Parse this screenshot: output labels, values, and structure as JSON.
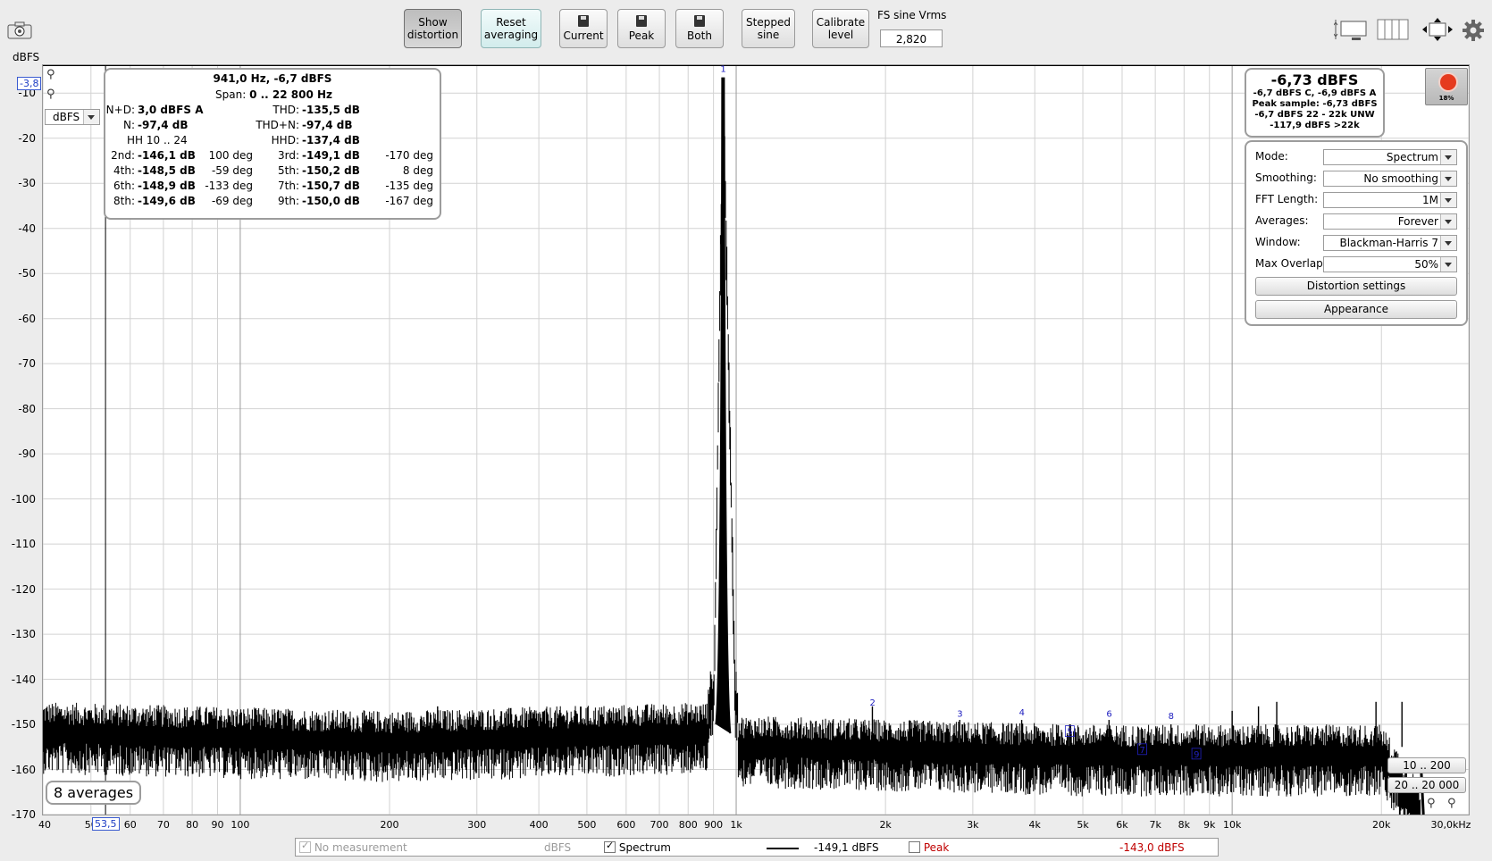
{
  "toolbar": {
    "show_distortion": [
      "Show",
      "distortion"
    ],
    "reset_averaging": [
      "Reset",
      "averaging"
    ],
    "current": "Current",
    "peak": "Peak",
    "both": "Both",
    "stepped_sine": [
      "Stepped",
      "sine"
    ],
    "calibrate_level": [
      "Calibrate",
      "level"
    ],
    "fs_label": "FS sine Vrms",
    "fs_value": "2,820"
  },
  "y_axis": {
    "unit": "dBFS",
    "selector": "dBFS",
    "cursor_value": "-3,8",
    "ticks": [
      "-10",
      "-20",
      "-30",
      "-40",
      "-50",
      "-60",
      "-70",
      "-80",
      "-90",
      "-100",
      "-110",
      "-120",
      "-130",
      "-140",
      "-150",
      "-160",
      "-170"
    ]
  },
  "x_axis": {
    "ticks": [
      "40",
      "50",
      "60",
      "70",
      "80",
      "90",
      "100",
      "200",
      "300",
      "400",
      "500",
      "600",
      "700",
      "800",
      "900",
      "1k",
      "2k",
      "3k",
      "4k",
      "5k",
      "6k",
      "7k",
      "8k",
      "9k",
      "10k",
      "20k",
      "30,0kHz"
    ],
    "cursor_value": "53,5"
  },
  "distortion_panel": {
    "title": "941,0 Hz, -6,7 dBFS",
    "span": "Span:",
    "span_value": "0 .. 22 800 Hz",
    "rows": [
      {
        "l1": "N+D:",
        "v1": "3,0 dBFS A",
        "l2": "THD:",
        "v2": "-135,5 dB",
        "p1": "",
        "p2": ""
      },
      {
        "l1": "N:",
        "v1": "-97,4 dB",
        "l2": "THD+N:",
        "v2": "-97,4 dB",
        "p1": "",
        "p2": ""
      },
      {
        "l1": "HH 10 .. 24",
        "v1": "",
        "l2": "HHD:",
        "v2": "-137,4 dB",
        "p1": "",
        "p2": ""
      },
      {
        "l1": "2nd:",
        "v1": "-146,1 dB",
        "p1": "100 deg",
        "l2": "3rd:",
        "v2": "-149,1 dB",
        "p2": "-170 deg"
      },
      {
        "l1": "4th:",
        "v1": "-148,5 dB",
        "p1": "-59 deg",
        "l2": "5th:",
        "v2": "-150,2 dB",
        "p2": "8 deg"
      },
      {
        "l1": "6th:",
        "v1": "-148,9 dB",
        "p1": "-133 deg",
        "l2": "7th:",
        "v2": "-150,7 dB",
        "p2": "-135 deg"
      },
      {
        "l1": "8th:",
        "v1": "-149,6 dB",
        "p1": "-69 deg",
        "l2": "9th:",
        "v2": "-150,0 dB",
        "p2": "-167 deg"
      }
    ]
  },
  "level_panel": {
    "main": "-6,73 dBFS",
    "lines": [
      "-6,7 dBFS C, -6,9 dBFS A",
      "Peak sample: -6,73 dBFS",
      "-6,7 dBFS 22 - 22k UNW",
      "-117,9 dBFS >22k"
    ]
  },
  "record": {
    "percent": "18%",
    "color": "#e53a1e"
  },
  "settings": [
    {
      "label": "Mode:",
      "value": "Spectrum"
    },
    {
      "label": "Smoothing:",
      "value": "No  smoothing"
    },
    {
      "label": "FFT Length:",
      "value": "1M"
    },
    {
      "label": "Averages:",
      "value": "Forever"
    },
    {
      "label": "Window:",
      "value": "Blackman-Harris 7"
    },
    {
      "label": "Max Overlap:",
      "value": "50%"
    }
  ],
  "buttons": {
    "distortion_settings": "Distortion settings",
    "appearance": "Appearance"
  },
  "averages_badge": "8 averages",
  "range_buttons": [
    "10 .. 200",
    "20 .. 20 000"
  ],
  "harmonic_markers": [
    "1",
    "2",
    "3",
    "4",
    "5",
    "6",
    "7",
    "8",
    "9"
  ],
  "legend": {
    "no_measurement": "No measurement",
    "no_measurement_unit": "dBFS",
    "spectrum": "Spectrum",
    "spectrum_value": "-149,1 dBFS",
    "peak": "Peak",
    "peak_value": "-143,0 dBFS",
    "peak_color": "#c00000"
  },
  "chart_data": {
    "type": "line",
    "x_scale": "log",
    "xlim": [
      40,
      30000
    ],
    "ylim": [
      -170,
      -3.8
    ],
    "ylabel": "dBFS",
    "fundamental": {
      "freq": 941,
      "level": -6.7
    },
    "noise_floor": [
      [
        40,
        -152
      ],
      [
        200,
        -154
      ],
      [
        900,
        -152
      ],
      [
        941,
        -8
      ],
      [
        1000,
        -155
      ],
      [
        5000,
        -157
      ],
      [
        10000,
        -157
      ],
      [
        20000,
        -157
      ],
      [
        24000,
        -170
      ]
    ],
    "spurs": [
      [
        250,
        -146
      ],
      [
        1882,
        -146
      ],
      [
        2823,
        -149
      ],
      [
        3764,
        -149
      ],
      [
        4705,
        -150
      ],
      [
        5646,
        -149
      ],
      [
        6587,
        -151
      ],
      [
        7528,
        -150
      ],
      [
        8469,
        -150
      ],
      [
        10000,
        -147
      ],
      [
        11300,
        -146
      ],
      [
        12300,
        -145
      ],
      [
        19500,
        -145
      ],
      [
        22000,
        -145
      ]
    ]
  }
}
